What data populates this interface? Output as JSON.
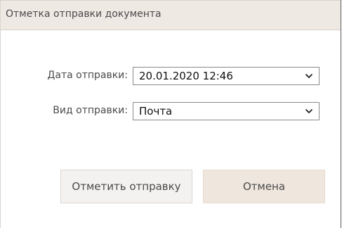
{
  "dialog": {
    "title": "Отметка отправки документа"
  },
  "form": {
    "send_date": {
      "label": "Дата отправки:",
      "value": "20.01.2020 12:46"
    },
    "send_type": {
      "label": "Вид отправки:",
      "value": "Почта"
    }
  },
  "buttons": {
    "mark_label": "Отметить отправку",
    "cancel_label": "Отмена"
  },
  "icons": {
    "dropdown": "chevron-down-icon"
  }
}
